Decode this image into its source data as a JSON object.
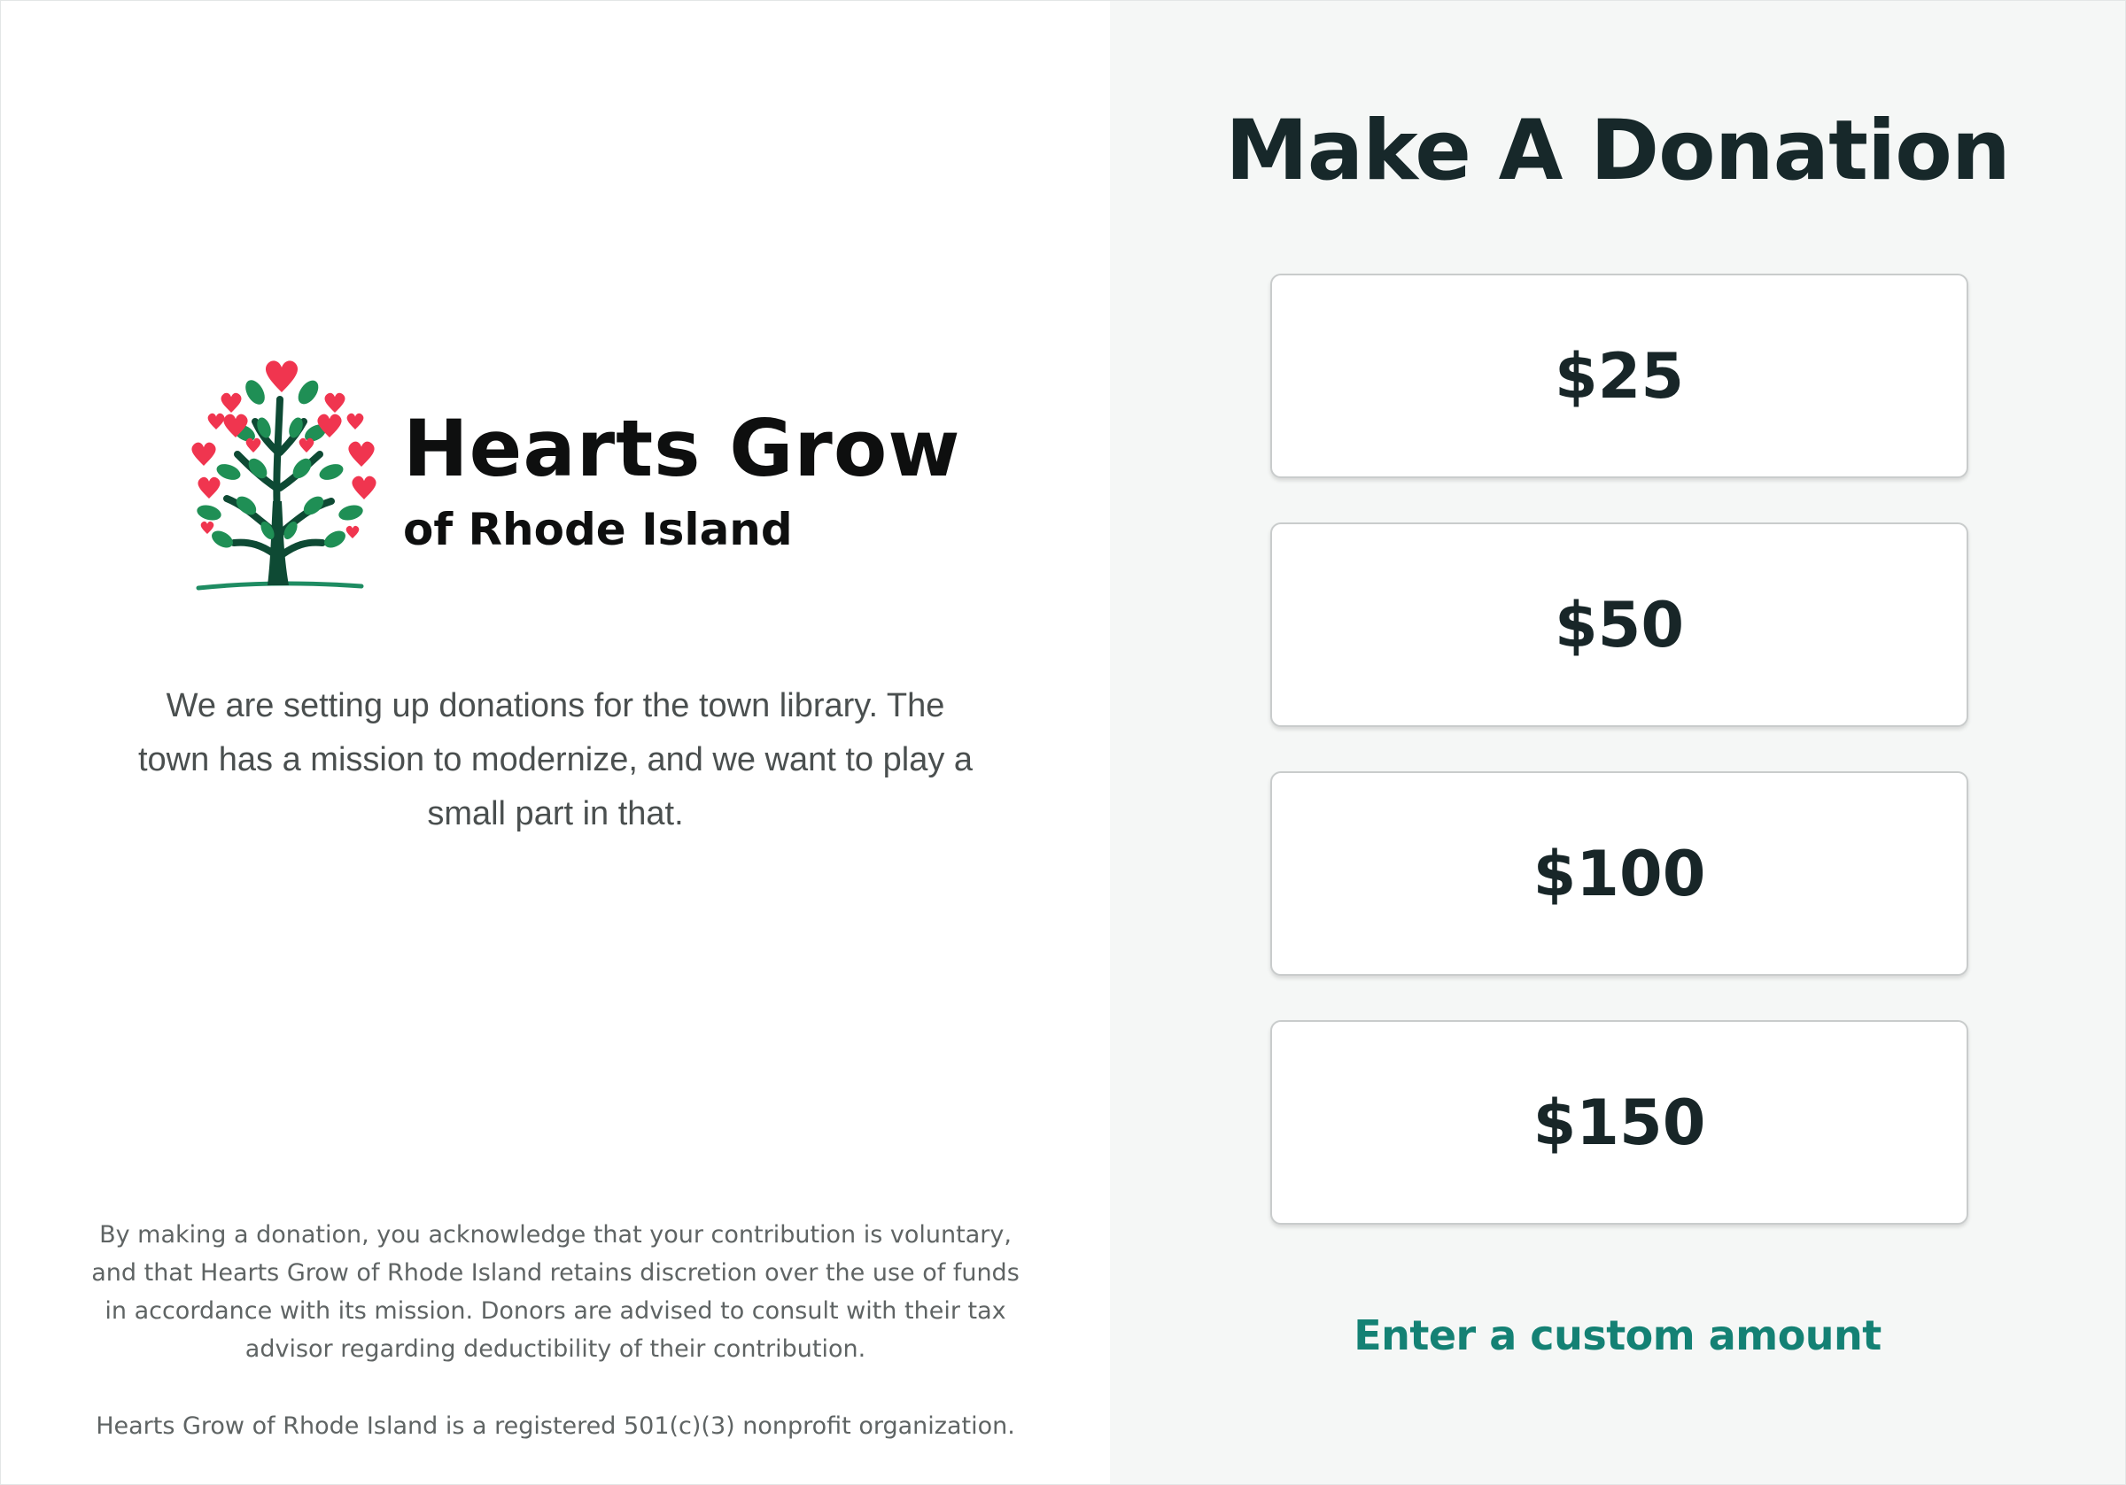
{
  "brand": {
    "title": "Hearts Grow",
    "subtitle": "of Rhode Island",
    "logo_icon": "heart-tree-icon",
    "colors": {
      "heart": "#f0354f",
      "leaf": "#1f8f55",
      "trunk": "#0e4a34",
      "ground": "#1e8c62"
    }
  },
  "mission": {
    "text": "We are setting up donations for the town library. The town has a mission to modernize, and we want to play a small part in that."
  },
  "legal": {
    "disclaimer": "By making a donation, you acknowledge that your contribution is voluntary, and that Hearts Grow of Rhode Island retains discretion over the use of funds in accordance with its mission. Donors are advised to consult with their tax advisor regarding deductibility of their contribution.",
    "nonprofit": "Hearts Grow of Rhode Island is a registered 501(c)(3) nonprofit organization."
  },
  "donation": {
    "heading": "Make A Donation",
    "amounts": [
      "$25",
      "$50",
      "$100",
      "$150"
    ],
    "custom_label": "Enter a custom amount",
    "accent_color": "#148174",
    "panel_background": "#f5f7f6"
  }
}
